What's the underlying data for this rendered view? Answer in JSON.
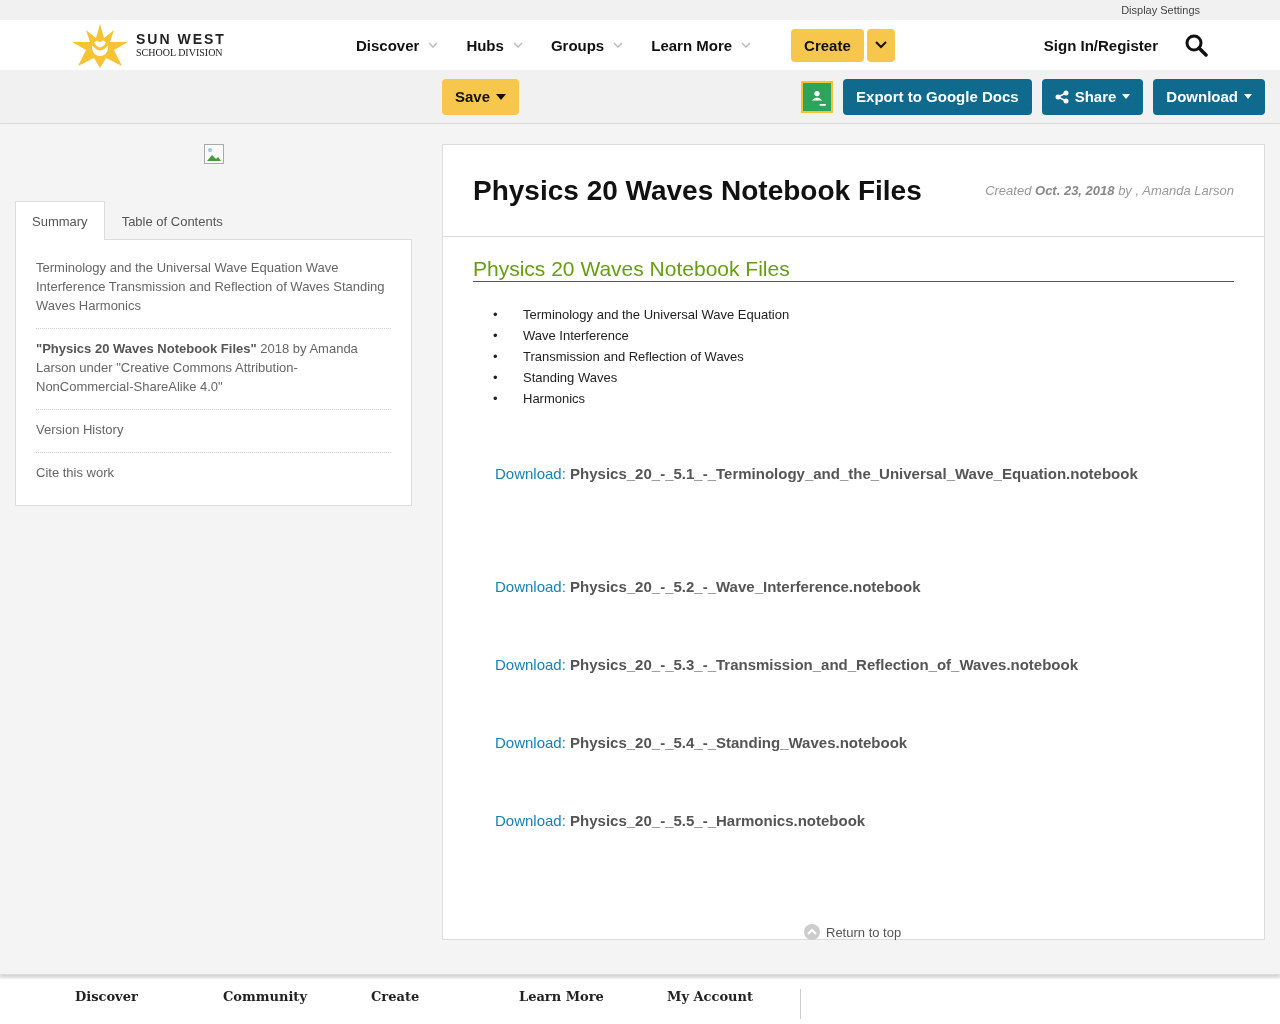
{
  "top_bar": {
    "display_settings": "Display Settings"
  },
  "header": {
    "logo": {
      "line_1": "SUN WEST",
      "line_2": "SCHOOL DIVISION"
    },
    "nav": [
      {
        "label": "Discover"
      },
      {
        "label": "Hubs"
      },
      {
        "label": "Groups"
      },
      {
        "label": "Learn More"
      }
    ],
    "create": "Create",
    "sign_in": "Sign In/Register"
  },
  "action_bar": {
    "save": "Save",
    "export": "Export to Google Docs",
    "share": "Share",
    "download": "Download"
  },
  "sidebar": {
    "tabs": [
      {
        "label": "Summary",
        "selected": true
      },
      {
        "label": "Table of Contents",
        "selected": false
      }
    ],
    "summary": "Terminology and the Universal Wave Equation Wave Interference Transmission and Reflection of Waves Standing Waves Harmonics",
    "attribution": "**\"Physics 20 Waves Notebook Files\"** 2018 by Amanda Larson under \"Creative Commons Attribution-NonCommercial-ShareAlike 4.0\"",
    "links": [
      "Version History",
      "Cite this work"
    ]
  },
  "content": {
    "title": "Physics 20 Waves Notebook Files",
    "meta": "Created **Oct. 23, 2018** by , Amanda Larson",
    "heading": "Physics 20 Waves Notebook Files",
    "bullets": [
      {
        "marker": "•",
        "text": "Terminology and the Universal Wave Equation"
      },
      {
        "marker": "•",
        "text": "Wave Interference"
      },
      {
        "marker": "•",
        "text": "Transmission and Reflection of Waves"
      },
      {
        "marker": "•",
        "text": "Standing Waves"
      },
      {
        "marker": "•",
        "text": "Harmonics"
      }
    ],
    "downloads": [
      {
        "label": "Download:",
        "file": "Physics_20_-_5.1_-_Terminology_and_the_Universal_Wave_Equation.notebook"
      },
      {
        "label": "Download:",
        "file": "Physics_20_-_5.2_-_Wave_Interference.notebook"
      },
      {
        "label": "Download:",
        "file": "Physics_20_-_5.3_-_Transmission_and_Reflection_of_Waves.notebook"
      },
      {
        "label": "Download:",
        "file": "Physics_20_-_5.4_-_Standing_Waves.notebook"
      },
      {
        "label": "Download:",
        "file": "Physics_20_-_5.5_-_Harmonics.notebook"
      }
    ]
  },
  "return_to_top": "Return to top",
  "footer": {
    "headings": [
      "Discover",
      "Community",
      "Create",
      "Learn More",
      "My Account"
    ]
  }
}
